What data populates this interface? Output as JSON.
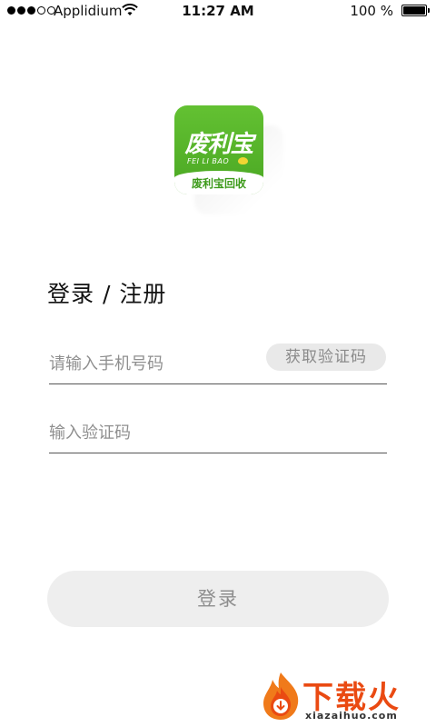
{
  "status_bar": {
    "carrier": "Applidium",
    "time": "11:27 AM",
    "battery_percent": "100 %"
  },
  "logo": {
    "main_text": "废利宝",
    "sub_text": "FEI LI BAO",
    "band_text": "废利宝回收",
    "brand_color": "#52b126"
  },
  "form": {
    "title": "登录 / 注册",
    "phone_placeholder": "请输入手机号码",
    "code_button_label": "获取验证码",
    "code_placeholder": "输入验证码",
    "login_button_label": "登录"
  },
  "watermark": {
    "text": "下载火",
    "domain": "xiazaihuo.com",
    "color": "#ea4a12"
  }
}
